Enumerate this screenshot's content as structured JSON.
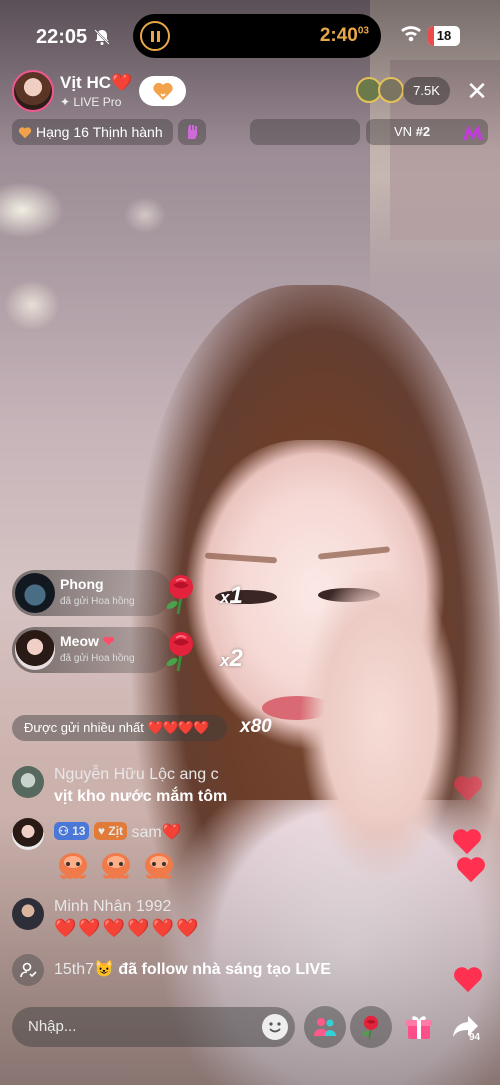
{
  "status_bar": {
    "time": "22:05",
    "recording_time": "2:40",
    "recording_subsec": "03",
    "battery": "18"
  },
  "host": {
    "name": "Vịt HC",
    "name_heart": "❤️",
    "subtitle": "LIVE Pro"
  },
  "viewers": {
    "count": "7.5K"
  },
  "rank": {
    "label": "Hạng 16 Thịnh hành",
    "region_label": "VN",
    "region_rank": "#2"
  },
  "gifts": [
    {
      "sender": "Phong",
      "action": "đã gửi Hoa hồng",
      "multiplier": "x",
      "count": "1"
    },
    {
      "sender": "Meow",
      "action": "đã gửi Hoa hồng",
      "multiplier": "x",
      "count": "2"
    }
  ],
  "most_sent": {
    "label": "Được gửi nhiều nhất",
    "hearts": "❤️❤️❤️❤️",
    "count": "x80"
  },
  "chat": [
    {
      "name": "Nguyễn Hữu Lộc ang c",
      "message": "vịt kho nước mắm tôm"
    },
    {
      "badge_level": "13",
      "badge_tag": "Zịt",
      "name": "sam",
      "name_suffix": "❤️"
    },
    {
      "name": "Minh Nhân 1992",
      "message": "❤️❤️❤️❤️❤️❤️"
    },
    {
      "name": "15th7",
      "message": "đã follow nhà sáng tạo LIVE"
    }
  ],
  "bottom": {
    "comment_placeholder": "Nhập...",
    "share_count": "94"
  },
  "colors": {
    "accent_record": "#e8a84a",
    "heart": "#ff3050",
    "host_ring": "#f0568f"
  }
}
